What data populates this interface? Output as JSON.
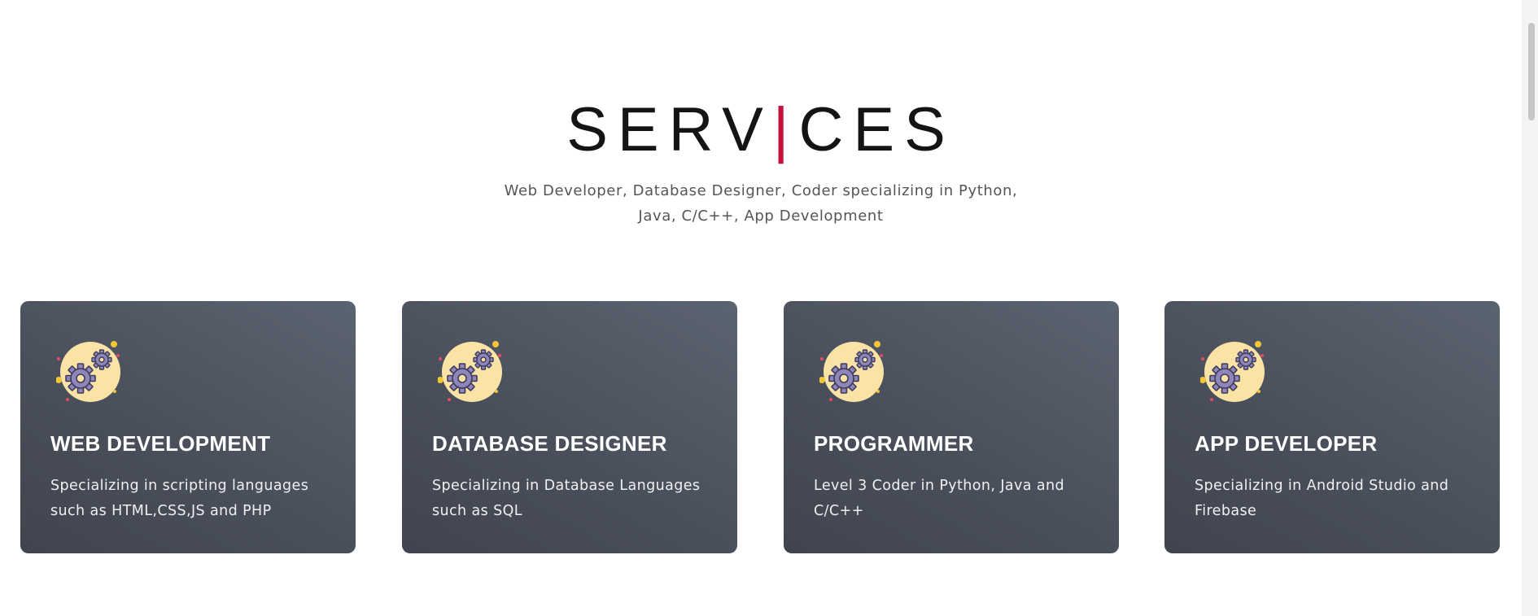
{
  "services": {
    "title_left": "SERV",
    "title_bar": "|",
    "title_right": "CES",
    "subtitle_line1": "Web Developer, Database Designer, Coder specializing in Python,",
    "subtitle_line2": "Java, C/C++, App Development",
    "accent_color": "#c8103c",
    "cards": [
      {
        "title": "WEB DEVELOPMENT",
        "description": "Specializing in scripting languages such as HTML,CSS,JS and PHP",
        "icon": "gears-icon"
      },
      {
        "title": "DATABASE DESIGNER",
        "description": "Specializing in Database Languages such as SQL",
        "icon": "gears-icon"
      },
      {
        "title": "PROGRAMMER",
        "description": "Level 3 Coder in Python, Java and C/C++",
        "icon": "gears-icon"
      },
      {
        "title": "APP DEVELOPER",
        "description": "Specializing in Android Studio and Firebase",
        "icon": "gears-icon"
      }
    ]
  }
}
